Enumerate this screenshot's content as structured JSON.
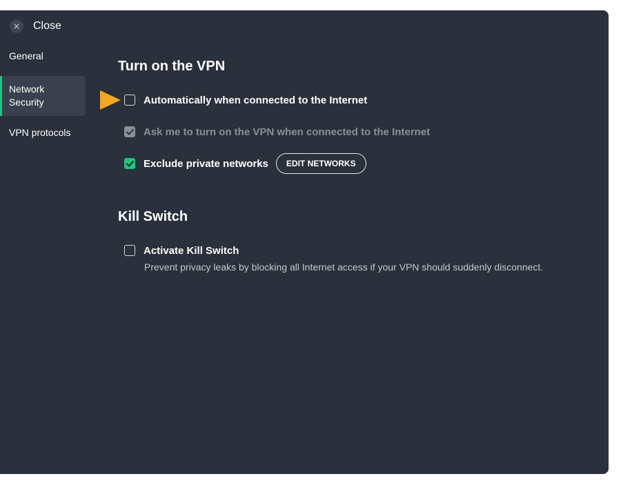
{
  "window": {
    "close_label": "Close",
    "close_icon": "close-icon"
  },
  "sidebar": {
    "items": [
      {
        "label": "General"
      },
      {
        "label": "Network Security",
        "active": true
      },
      {
        "label": "VPN protocols"
      }
    ]
  },
  "vpn_section": {
    "title": "Turn on the VPN",
    "options": [
      {
        "label": "Automatically when connected to the Internet",
        "checked": false,
        "disabled": false
      },
      {
        "label": "Ask me to turn on the VPN when connected to the Internet",
        "checked": true,
        "disabled": true
      },
      {
        "label": "Exclude private networks",
        "checked": true,
        "disabled": false
      }
    ],
    "edit_networks_label": "EDIT NETWORKS"
  },
  "kill_switch_section": {
    "title": "Kill Switch",
    "option_label": "Activate Kill Switch",
    "option_checked": false,
    "description": "Prevent privacy leaks by blocking all Internet access if your VPN should suddenly disconnect."
  },
  "colors": {
    "background": "#2a303c",
    "accent_green": "#22c47a",
    "pointer_orange": "#f5a623",
    "disabled_gray": "#8a8f99"
  }
}
